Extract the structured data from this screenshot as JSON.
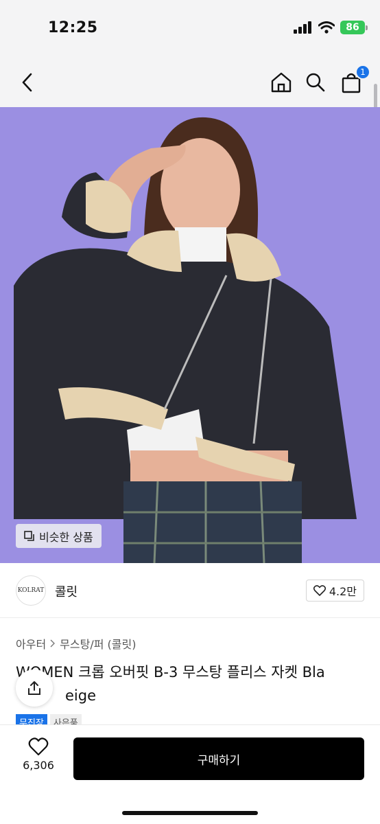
{
  "status_bar": {
    "time": "12:25",
    "battery": "86",
    "icons": [
      "signal-icon",
      "wifi-icon",
      "battery-icon"
    ]
  },
  "nav": {
    "icons": [
      "back-chevron-icon",
      "home-icon",
      "search-icon",
      "shopping-bag-icon"
    ],
    "cart_count": "1"
  },
  "hero": {
    "similar_products_label": "비슷한 상품"
  },
  "brand": {
    "logo_text": "KOLRAT",
    "name": "콜릿",
    "likes": "4.2만"
  },
  "product": {
    "breadcrumb": [
      "아우터",
      "무스탕/퍼 (콜릿)"
    ],
    "title": "WOMEN 크롭 오버핏 B-3 무스탕 플리스 자켓 Bla",
    "title_line2": "eige",
    "tags": [
      "무진장",
      "사은품"
    ]
  },
  "bottom_bar": {
    "wish_count": "6,306",
    "buy_label": "구매하기"
  },
  "colors": {
    "hero_background": "#9b8fe2",
    "accent_blue": "#1a73e8",
    "battery_green": "#35c759",
    "buy_button": "#000000"
  }
}
